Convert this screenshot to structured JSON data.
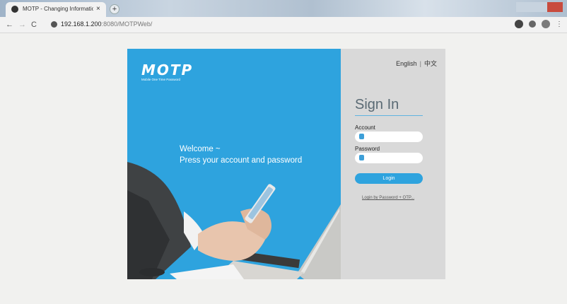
{
  "browser": {
    "tab_title": "MOTP - Changing Information",
    "tab_close": "×",
    "new_tab": "+",
    "url_host": "192.168.1.200",
    "url_rest": ":8080/MOTPWeb/",
    "nav_back": "←",
    "nav_forward": "→",
    "nav_reload": "C",
    "menu": "⋮"
  },
  "logo": {
    "word": "MOTP",
    "tagline": "Mobile One Time Password"
  },
  "hero": {
    "welcome_line1": "Welcome ~",
    "welcome_line2": "Press your account and password"
  },
  "lang": {
    "english": "English",
    "separator": "|",
    "chinese": "中文"
  },
  "form": {
    "title": "Sign In",
    "account_label": "Account",
    "account_value": "",
    "password_label": "Password",
    "password_value": "",
    "login_label": "Login",
    "otp_link": "Login by Password + OTP..."
  },
  "colors": {
    "accent": "#2ea3de",
    "panel": "#d9d9d9"
  }
}
